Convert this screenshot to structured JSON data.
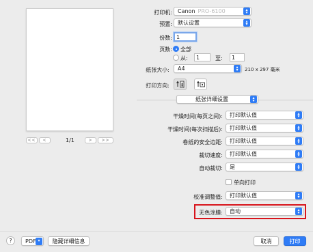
{
  "preview": {
    "page_indicator": "1/1",
    "nav_first": "<<",
    "nav_prev": "<",
    "nav_next": ">",
    "nav_last": ">>"
  },
  "printer": {
    "label": "打印机:",
    "value": "Canon",
    "value_blur": "PRO-6100"
  },
  "preset": {
    "label": "预置:",
    "value": "默认设置"
  },
  "copies": {
    "label": "份数:",
    "value": "1"
  },
  "pages": {
    "label": "页数:",
    "all_label": "全部",
    "from_label": "从:",
    "from_value": "1",
    "to_label": "至:",
    "to_value": "1"
  },
  "paper_size": {
    "label": "纸张大小:",
    "value": "A4",
    "dims": "210 x 297 毫米"
  },
  "orientation": {
    "label": "打印方向:"
  },
  "section_popup": {
    "value": "纸张详细设置"
  },
  "settings": [
    {
      "label": "干燥时间(每页之间):",
      "value": "打印默认值"
    },
    {
      "label": "干燥时间(每次扫描后):",
      "value": "打印默认值"
    },
    {
      "label": "卷纸的安全边距:",
      "value": "打印默认值"
    },
    {
      "label": "裁切速度:",
      "value": "打印默认值"
    },
    {
      "label": "自动裁切:",
      "value": "是"
    }
  ],
  "one_way": {
    "label": "单向打印"
  },
  "calibration": {
    "label": "校准调整值:",
    "value": "打印默认值"
  },
  "colorless_coating": {
    "label": "无色涂膜:",
    "value": "自动"
  },
  "footer": {
    "help": "?",
    "pdf": "PDF",
    "hide_details": "隐藏详细信息",
    "cancel": "取消",
    "print": "打印"
  },
  "colors": {
    "accent": "#2f7cf6",
    "highlight": "#d8141c"
  }
}
